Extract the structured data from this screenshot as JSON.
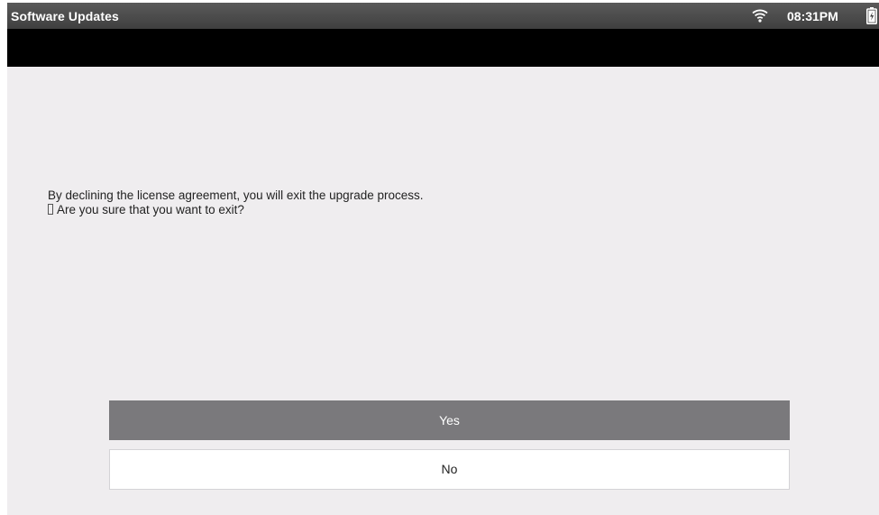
{
  "status_bar": {
    "title": "Software Updates",
    "time": "08:31PM",
    "icons": [
      "wifi-icon",
      "battery-icon"
    ]
  },
  "dialog": {
    "message_line1": "By declining the license agreement, you will exit the upgrade process.",
    "message_line2": "Are you sure that you want to exit?",
    "yes_label": "Yes",
    "no_label": "No"
  },
  "colors": {
    "status_bar": "#4a4a4a",
    "band": "#000000",
    "background": "#efedef",
    "yes_button": "#7a797c",
    "no_button": "#ffffff"
  }
}
